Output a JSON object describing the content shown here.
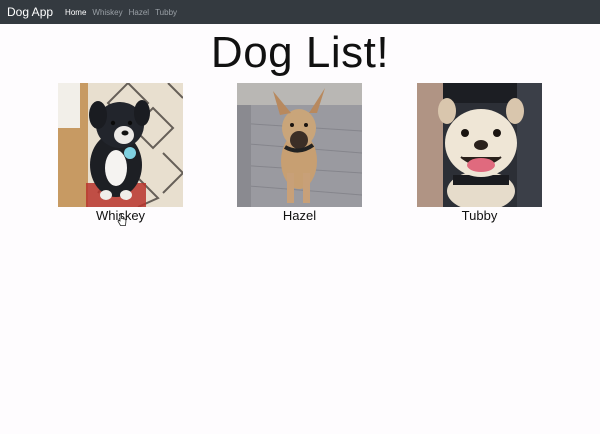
{
  "navbar": {
    "brand": "Dog App",
    "links": [
      "Home",
      "Whiskey",
      "Hazel",
      "Tubby"
    ]
  },
  "page": {
    "title": "Dog List!"
  },
  "dogs": [
    {
      "name": "Whiskey"
    },
    {
      "name": "Hazel"
    },
    {
      "name": "Tubby"
    }
  ],
  "colors": {
    "navbar_bg": "#343a40",
    "page_bg": "#fefcfe",
    "nav_active": "#ffffff",
    "nav_inactive": "#9aa0a6"
  }
}
